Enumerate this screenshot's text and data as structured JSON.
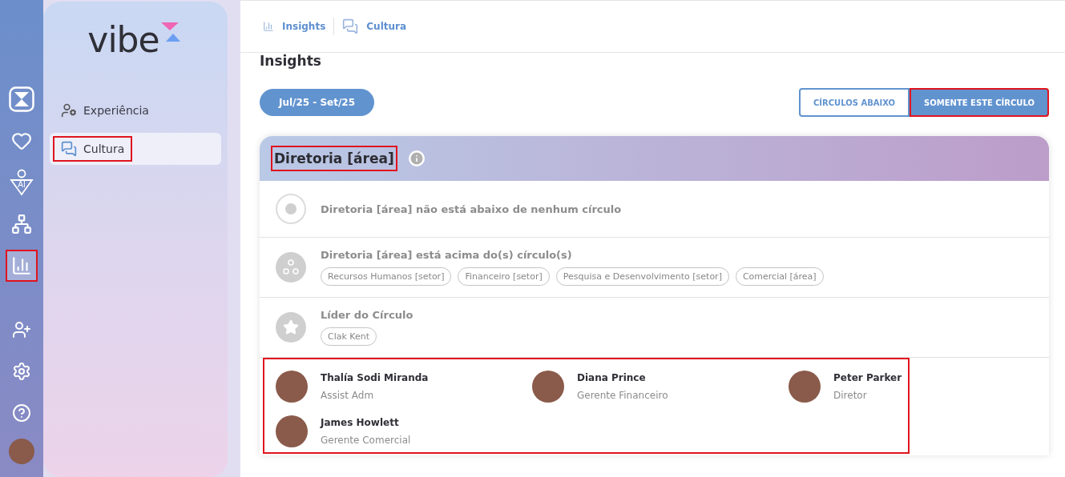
{
  "rail": {
    "items": [
      {
        "kind": "hourglass",
        "selected": false,
        "highlighted": false
      },
      {
        "kind": "heart",
        "selected": false,
        "highlighted": false
      },
      {
        "kind": "ai",
        "label": "AI",
        "selected": false,
        "highlighted": false
      },
      {
        "kind": "network",
        "selected": false,
        "highlighted": false
      },
      {
        "kind": "chart",
        "selected": true,
        "highlighted": true
      },
      {
        "kind": "gap"
      },
      {
        "kind": "user-plus",
        "selected": false,
        "highlighted": false
      },
      {
        "kind": "settings",
        "selected": false,
        "highlighted": false
      },
      {
        "kind": "help",
        "selected": false,
        "highlighted": false
      },
      {
        "kind": "avatar"
      }
    ]
  },
  "sidebar": {
    "logo": "vibe",
    "items": [
      {
        "label": "Experiência",
        "kind": "person-star",
        "selected": false,
        "highlighted": false
      },
      {
        "label": "Cultura",
        "kind": "chat",
        "selected": true,
        "highlighted": true
      }
    ]
  },
  "breadcrumb": [
    {
      "label": "Insights",
      "kind": "chart"
    },
    {
      "label": "Cultura",
      "kind": "chat"
    }
  ],
  "page_title": "Insights",
  "period_button": "Jul/25 - Set/25",
  "scope_buttons": [
    {
      "label": "CÍRCULOS ABAIXO",
      "selected": false,
      "highlighted": false
    },
    {
      "label": "SOMENTE ESTE CÍRCULO",
      "selected": true,
      "highlighted": true
    }
  ],
  "card": {
    "title": "Diretoria [área]",
    "title_highlighted": true,
    "rows": [
      {
        "kind": "dot",
        "text": "Diretoria [área] não está abaixo de nenhum círculo"
      },
      {
        "kind": "circles",
        "text": "Diretoria [área] está acima do(s) círculo(s)",
        "tags": [
          "Recursos Humanos [setor]",
          "Financeiro [setor]",
          "Pesquisa e Desenvolvimento [setor]",
          "Comercial [área]"
        ]
      },
      {
        "kind": "star",
        "text": "Líder do Círculo",
        "tags": [
          "Clak Kent"
        ]
      }
    ],
    "members_highlighted": true,
    "members": [
      {
        "name": "Thalía Sodi Miranda",
        "role": "Assist Adm"
      },
      {
        "name": "Diana Prince",
        "role": "Gerente Financeiro"
      },
      {
        "name": "Peter Parker",
        "role": "Diretor"
      },
      {
        "name": "James Howlett",
        "role": "Gerente Comercial"
      }
    ]
  }
}
